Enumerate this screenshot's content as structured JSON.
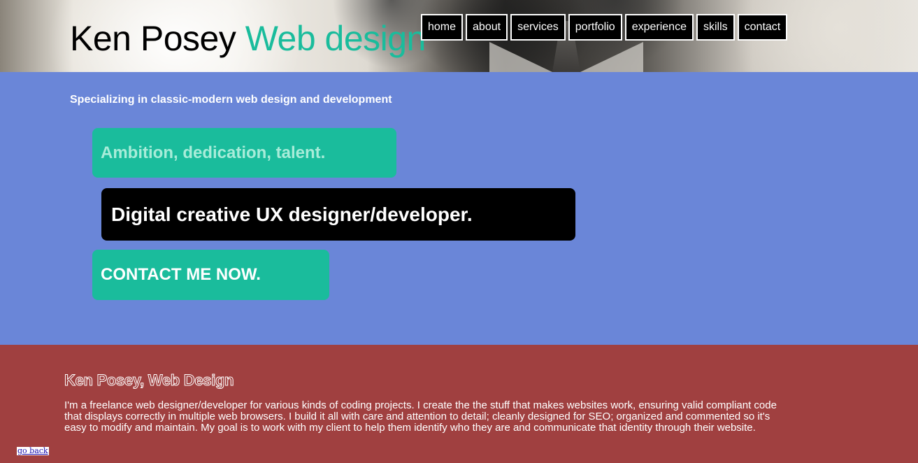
{
  "header": {
    "title_main": "Ken Posey",
    "title_accent": "Web design",
    "nav": [
      {
        "label": "home"
      },
      {
        "label": "about"
      },
      {
        "label": "services"
      },
      {
        "label": "portfolio"
      },
      {
        "label": "experience"
      },
      {
        "label": "skills"
      },
      {
        "label": "contact"
      }
    ]
  },
  "hero": {
    "tagline": "Specializing in classic-modern web design and development",
    "ambition": "Ambition, dedication, talent.",
    "digital": "Digital creative UX designer/developer.",
    "contact_cta": "CONTACT ME NOW."
  },
  "about": {
    "heading": "Ken Posey, Web Design",
    "body": "I'm a freelance web designer/developer for various kinds of coding projects. I create the the stuff that makes websites work, ensuring valid compliant code that displays correctly in multiple web browsers. I build it all with care and attention to detail; cleanly designed for SEO; organized and commented so it's easy to modify and maintain. My goal is to work with my client to help them identify who they are and communicate that identity through their website."
  },
  "footer": {
    "go_back": "go back"
  },
  "colors": {
    "accent": "#1abc9c",
    "hero_bg": "#6a86d8",
    "about_bg": "#a04040"
  }
}
